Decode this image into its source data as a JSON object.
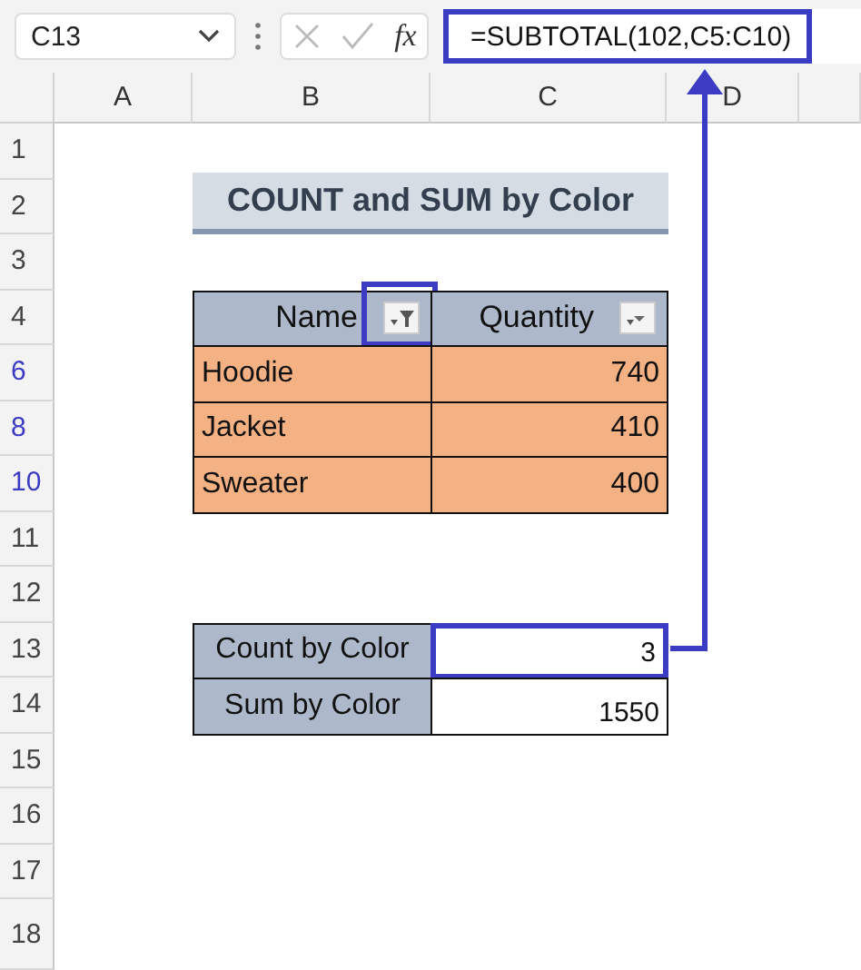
{
  "name_box": "C13",
  "fx_label": "fx",
  "formula": "=SUBTOTAL(102,C5:C10)",
  "columns": [
    "A",
    "B",
    "C",
    "D"
  ],
  "rows": [
    {
      "label": "1",
      "filtered": false
    },
    {
      "label": "2",
      "filtered": false
    },
    {
      "label": "3",
      "filtered": false
    },
    {
      "label": "4",
      "filtered": false
    },
    {
      "label": "6",
      "filtered": true
    },
    {
      "label": "8",
      "filtered": true
    },
    {
      "label": "10",
      "filtered": true
    },
    {
      "label": "11",
      "filtered": false
    },
    {
      "label": "12",
      "filtered": false
    },
    {
      "label": "13",
      "filtered": false
    },
    {
      "label": "14",
      "filtered": false
    },
    {
      "label": "15",
      "filtered": false
    },
    {
      "label": "16",
      "filtered": false
    },
    {
      "label": "17",
      "filtered": false
    },
    {
      "label": "18",
      "filtered": false
    }
  ],
  "title": "COUNT and SUM by Color",
  "table": {
    "headers": [
      {
        "text": "Name",
        "filter_active": true
      },
      {
        "text": "Quantity",
        "filter_active": false
      }
    ],
    "rows": [
      [
        "Hoodie",
        "740"
      ],
      [
        "Jacket",
        "410"
      ],
      [
        "Sweater",
        "400"
      ]
    ]
  },
  "summary": [
    {
      "label": "Count by Color",
      "value": "3",
      "selected": true
    },
    {
      "label": "Sum by Color",
      "value": "1550",
      "selected": false
    }
  ]
}
